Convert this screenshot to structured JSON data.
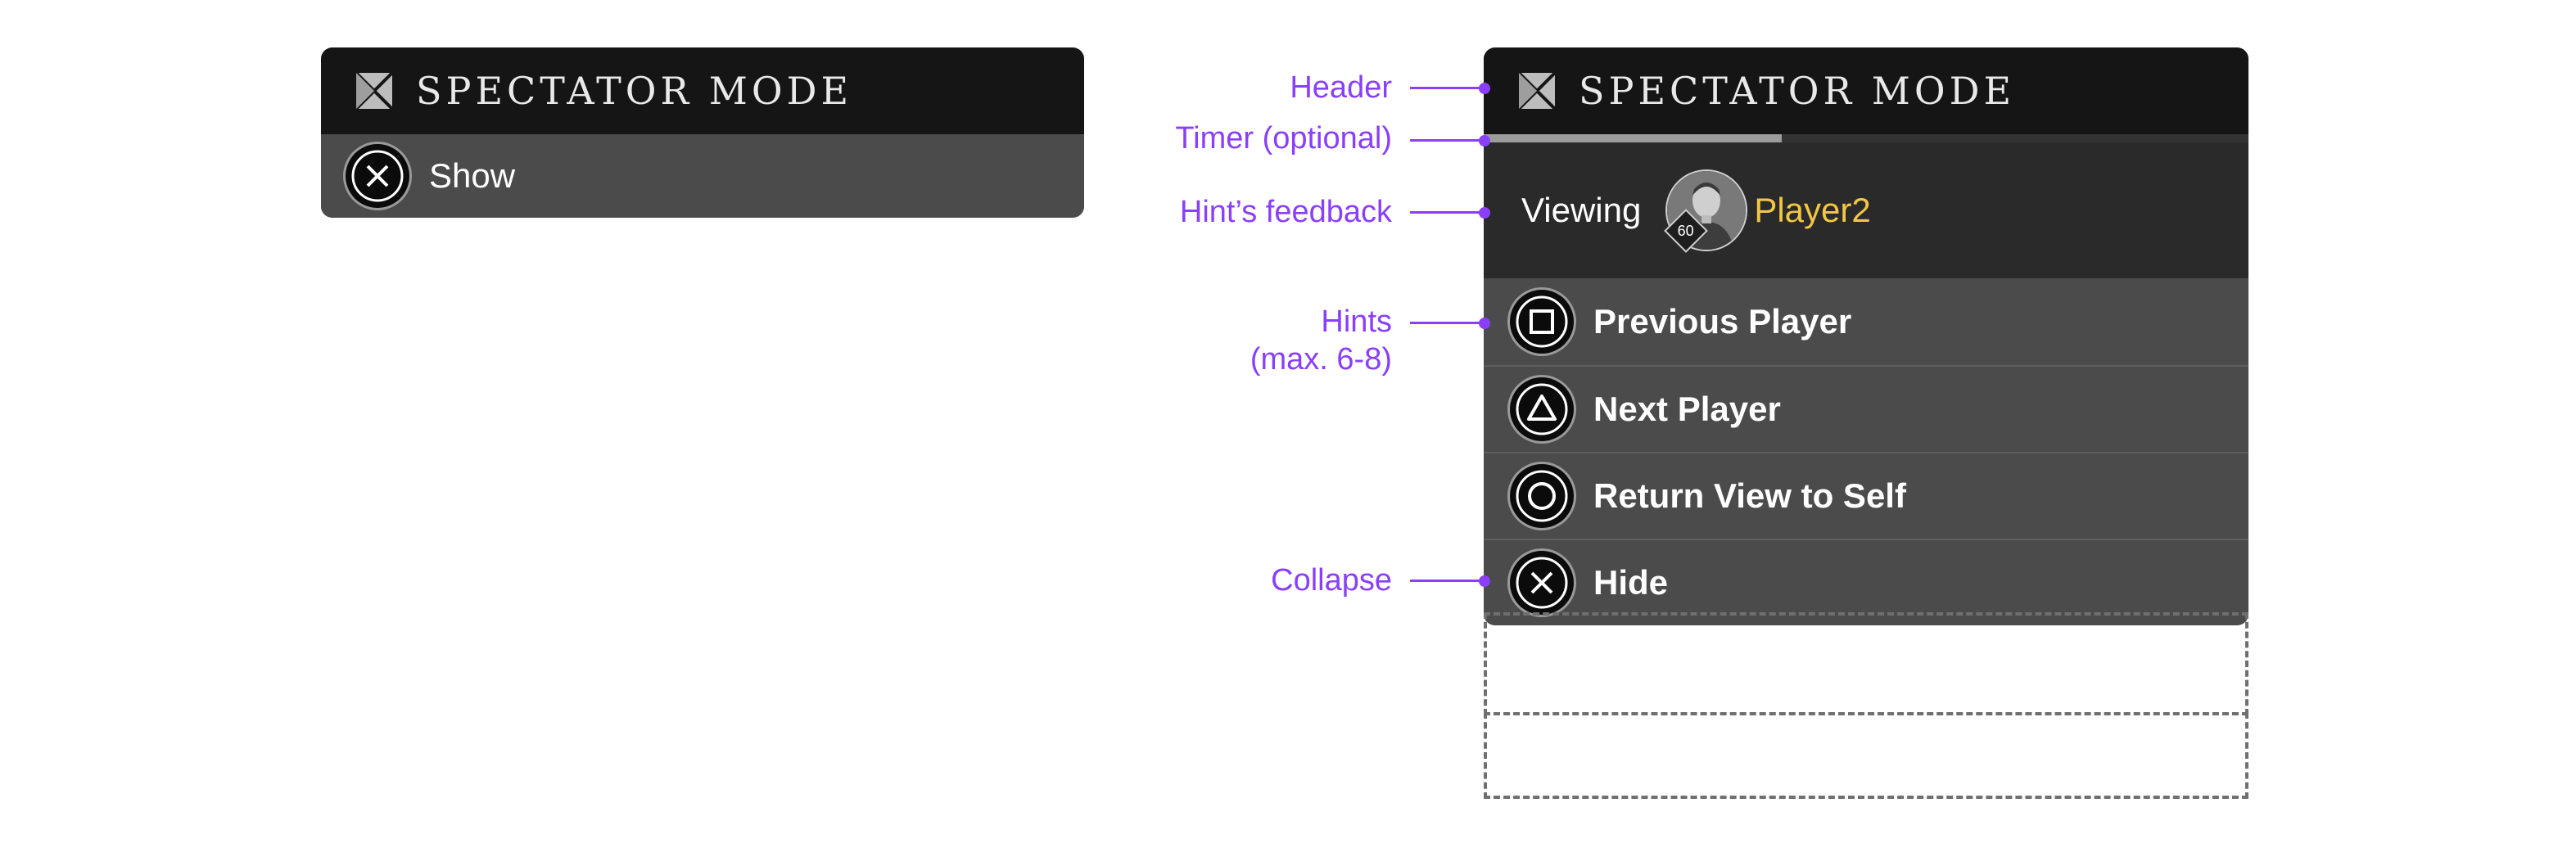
{
  "small_panel": {
    "header_title": "SPECTATOR MODE",
    "logo_icon": "crossed-square-logo-icon",
    "show": {
      "icon": "cross-button-icon",
      "label": "Show"
    }
  },
  "main_panel": {
    "header_title": "SPECTATOR MODE",
    "logo_icon": "crossed-square-logo-icon",
    "timer_progress": 0.39,
    "feedback": {
      "viewing_label": "Viewing",
      "player_name": "Player2",
      "player_level": "60",
      "avatar_icon": "player-portrait"
    },
    "hints": [
      {
        "icon": "square-button-icon",
        "label": "Previous Player"
      },
      {
        "icon": "triangle-button-icon",
        "label": "Next Player"
      },
      {
        "icon": "circle-button-icon",
        "label": "Return View to Self"
      }
    ],
    "collapse": {
      "icon": "cross-button-icon",
      "label": "Hide"
    }
  },
  "annotations": {
    "header": "Header",
    "timer": "Timer (optional)",
    "feedback": "Hint’s feedback",
    "hints_line1": "Hints",
    "hints_line2": "(max. 6-8)",
    "collapse": "Collapse"
  },
  "colors": {
    "annotation": "#8a3ffc",
    "player_name": "#f2c744",
    "header_bg": "#151515",
    "row_bg": "#4b4b4b",
    "feedback_bg": "#2a2a2a"
  }
}
